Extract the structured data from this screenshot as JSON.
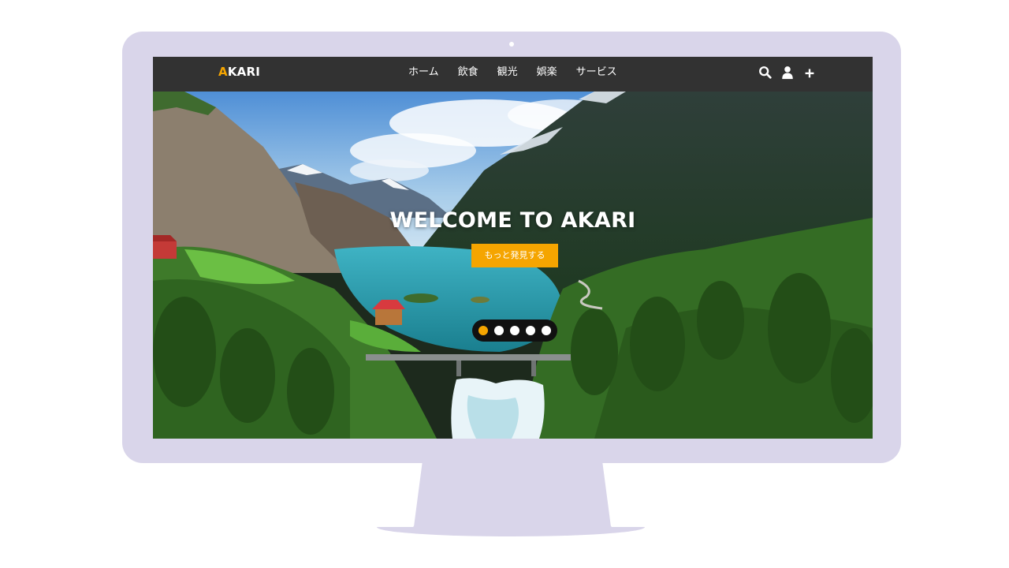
{
  "brand": {
    "logo_first": "A",
    "logo_rest": "KARI",
    "accent_color": "#f5a500"
  },
  "nav": {
    "items": [
      "ホーム",
      "飲食",
      "観光",
      "娯楽",
      "サービス"
    ],
    "icons": [
      "search-icon",
      "user-icon",
      "plus-icon"
    ]
  },
  "hero": {
    "title": "WELCOME TO AKARI",
    "button_label": "もっと発見する",
    "image_subject": "mountain-lake-valley-landscape"
  },
  "carousel": {
    "slide_count": 5,
    "active_index": 0
  },
  "colors": {
    "monitor": "#d9d5ea",
    "navbar": "#323232"
  }
}
